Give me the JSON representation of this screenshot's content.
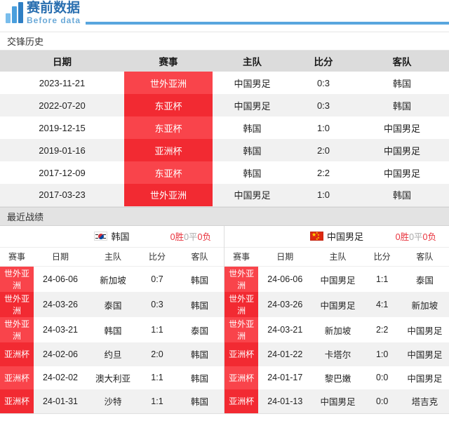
{
  "header": {
    "logo_cn": "赛前数据",
    "logo_en": "Before data",
    "accent_blue": "#59a6de",
    "logo_blue": "#2a6fb0"
  },
  "h2h": {
    "section_title": "交锋历史",
    "columns": [
      "日期",
      "赛事",
      "主队",
      "比分",
      "客队"
    ],
    "rows": [
      {
        "date": "2023-11-21",
        "comp": "世外亚洲",
        "home": "中国男足",
        "score": "0:3",
        "away": "韩国"
      },
      {
        "date": "2022-07-20",
        "comp": "东亚杯",
        "home": "中国男足",
        "score": "0:3",
        "away": "韩国"
      },
      {
        "date": "2019-12-15",
        "comp": "东亚杯",
        "home": "韩国",
        "score": "1:0",
        "away": "中国男足"
      },
      {
        "date": "2019-01-16",
        "comp": "亚洲杯",
        "home": "韩国",
        "score": "2:0",
        "away": "中国男足"
      },
      {
        "date": "2017-12-09",
        "comp": "东亚杯",
        "home": "韩国",
        "score": "2:2",
        "away": "中国男足"
      },
      {
        "date": "2017-03-23",
        "comp": "世外亚洲",
        "home": "中国男足",
        "score": "1:0",
        "away": "韩国"
      }
    ]
  },
  "recent": {
    "section_title": "最近战绩",
    "columns": [
      "赛事",
      "日期",
      "主队",
      "比分",
      "客队"
    ],
    "left": {
      "team_name": "韩国",
      "flag": "korea-flag-icon",
      "record": {
        "win": "0胜",
        "draw": "0平",
        "lose": "0负"
      },
      "rows": [
        {
          "comp": "世外亚洲",
          "date": "24-06-06",
          "home": "新加坡",
          "score": "0:7",
          "away": "韩国"
        },
        {
          "comp": "世外亚洲",
          "date": "24-03-26",
          "home": "泰国",
          "score": "0:3",
          "away": "韩国"
        },
        {
          "comp": "世外亚洲",
          "date": "24-03-21",
          "home": "韩国",
          "score": "1:1",
          "away": "泰国"
        },
        {
          "comp": "亚洲杯",
          "date": "24-02-06",
          "home": "约旦",
          "score": "2:0",
          "away": "韩国"
        },
        {
          "comp": "亚洲杯",
          "date": "24-02-02",
          "home": "澳大利亚",
          "score": "1:1",
          "away": "韩国"
        },
        {
          "comp": "亚洲杯",
          "date": "24-01-31",
          "home": "沙特",
          "score": "1:1",
          "away": "韩国"
        }
      ]
    },
    "right": {
      "team_name": "中国男足",
      "flag": "china-flag-icon",
      "record": {
        "win": "0胜",
        "draw": "0平",
        "lose": "0负"
      },
      "rows": [
        {
          "comp": "世外亚洲",
          "date": "24-06-06",
          "home": "中国男足",
          "score": "1:1",
          "away": "泰国"
        },
        {
          "comp": "世外亚洲",
          "date": "24-03-26",
          "home": "中国男足",
          "score": "4:1",
          "away": "新加坡"
        },
        {
          "comp": "世外亚洲",
          "date": "24-03-21",
          "home": "新加坡",
          "score": "2:2",
          "away": "中国男足"
        },
        {
          "comp": "亚洲杯",
          "date": "24-01-22",
          "home": "卡塔尔",
          "score": "1:0",
          "away": "中国男足"
        },
        {
          "comp": "亚洲杯",
          "date": "24-01-17",
          "home": "黎巴嫩",
          "score": "0:0",
          "away": "中国男足"
        },
        {
          "comp": "亚洲杯",
          "date": "24-01-13",
          "home": "中国男足",
          "score": "0:0",
          "away": "塔吉克"
        }
      ]
    }
  }
}
